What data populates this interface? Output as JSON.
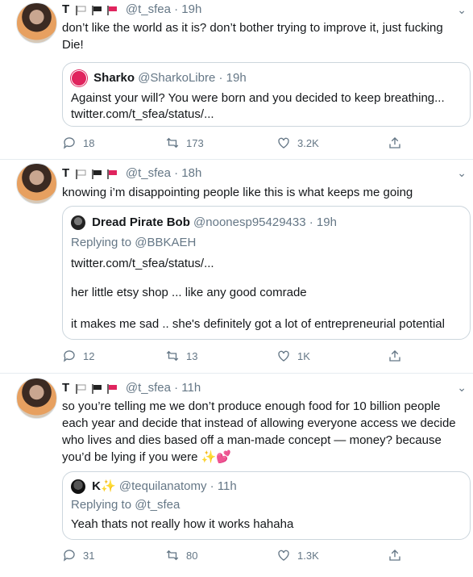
{
  "tweets": [
    {
      "name": "T",
      "handle": "@t_sfea",
      "time": "19h",
      "text": "don’t like the world as it is? don’t bother trying to improve it, just fucking Die!",
      "quote": {
        "name": "Sharko",
        "handle": "@SharkoLibre",
        "time": "19h",
        "replying_to": "",
        "lines": [
          "Against your will? You were born and you decided to keep breathing...",
          "twitter.com/t_sfea/status/..."
        ]
      },
      "replies": "18",
      "retweets": "173",
      "likes": "3.2K"
    },
    {
      "name": "T",
      "handle": "@t_sfea",
      "time": "18h",
      "text": "knowing i’m disappointing people like this is what keeps me going",
      "quote": {
        "name": "Dread Pirate Bob",
        "handle": "@noonesp95429433",
        "time": "19h",
        "replying_to": "Replying to @BBKAEH",
        "lines": [
          "twitter.com/t_sfea/status/...",
          "her little etsy shop ... like any good comrade",
          "it makes me sad .. she's definitely got a lot of entrepreneurial potential"
        ]
      },
      "replies": "12",
      "retweets": "13",
      "likes": "1K"
    },
    {
      "name": "T",
      "handle": "@t_sfea",
      "time": "11h",
      "text": "so you’re telling me we don’t produce enough food for 10 billion people each year and decide that instead of allowing everyone access we decide who lives and dies based off a man-made concept — money? because you’d be lying if you were ✨💕",
      "quote": {
        "name": "K✨",
        "handle": "@tequilanatomy",
        "time": "11h",
        "replying_to": "Replying to @t_sfea",
        "lines": [
          "Yeah thats not really how it works hahaha"
        ]
      },
      "replies": "31",
      "retweets": "80",
      "likes": "1.3K"
    }
  ],
  "colors": {
    "text": "#14171a",
    "muted": "#657786",
    "border": "#e6ecf0",
    "flag_red": "#e0245e"
  }
}
